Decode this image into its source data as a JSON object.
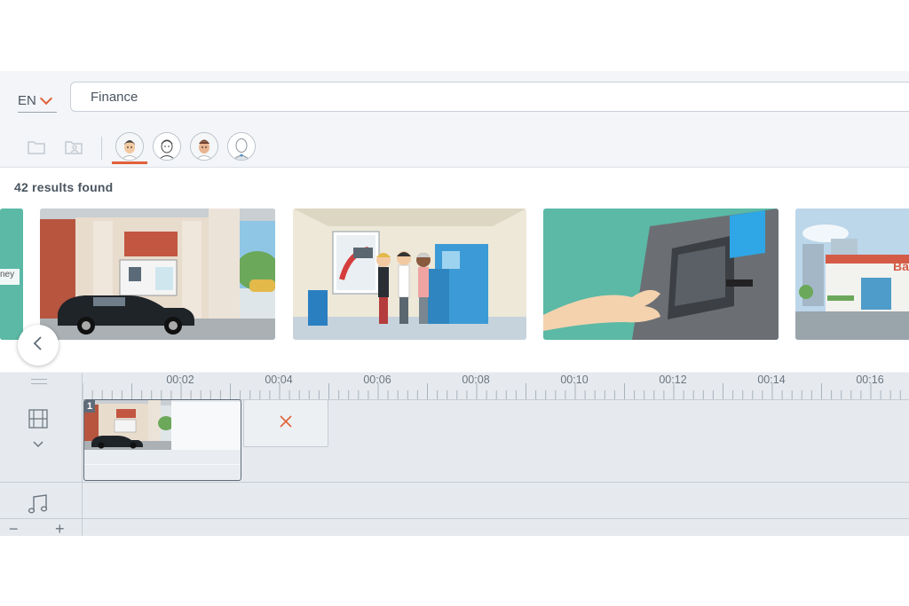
{
  "toolbar": {
    "language": "EN",
    "search_value": "Finance"
  },
  "filters": {
    "icons": [
      "folder-icon",
      "image-folder-icon"
    ],
    "avatars": [
      "avatar-style-1",
      "avatar-style-2",
      "avatar-style-3",
      "avatar-style-4"
    ]
  },
  "results": {
    "count_text": "42 results found",
    "thumbnails": [
      {
        "name": "thumb-partial-left",
        "visible_text": "ney"
      },
      {
        "name": "thumb-atm-drive-through"
      },
      {
        "name": "thumb-people-at-atm"
      },
      {
        "name": "thumb-hand-at-atm"
      },
      {
        "name": "thumb-bank-building",
        "visible_text": "Ba"
      }
    ]
  },
  "timeline": {
    "ticks": [
      "00:02",
      "00:04",
      "00:06",
      "00:08",
      "00:10",
      "00:12",
      "00:14",
      "00:16"
    ],
    "clip_number": "1",
    "zoom_out": "−",
    "zoom_in": "+"
  },
  "colors": {
    "accent": "#e0623a",
    "teal": "#5bb9a6",
    "background": "#f3f5f8"
  }
}
